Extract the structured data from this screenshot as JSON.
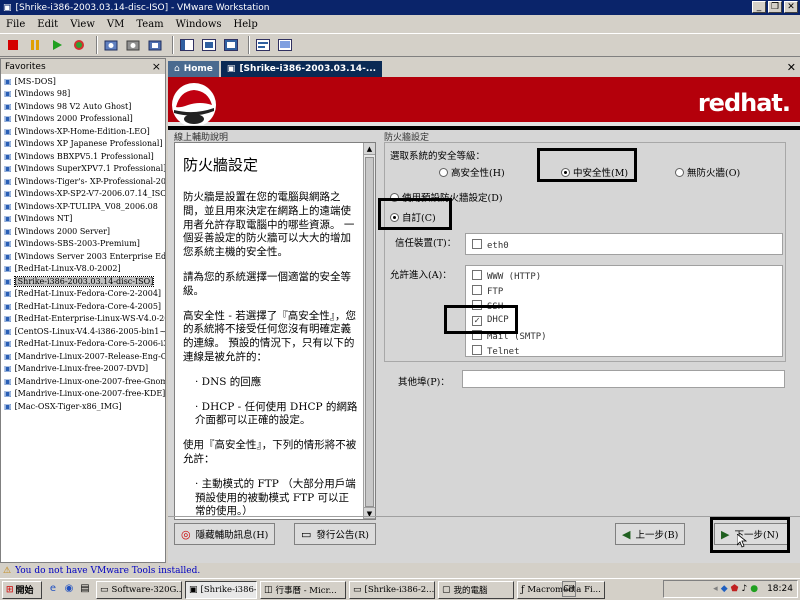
{
  "window": {
    "title": "[Shrike-i386-2003.03.14-disc-ISO] - VMware Workstation",
    "min": "_",
    "max": "❐",
    "close": "✕"
  },
  "menu": [
    "File",
    "Edit",
    "View",
    "VM",
    "Team",
    "Windows",
    "Help"
  ],
  "toolbar_icons": [
    "stop-icon",
    "pause-icon",
    "play-icon",
    "reset-icon",
    "snapshot-icon",
    "revert-icon",
    "manage-snapshots-icon",
    "sidebar-toggle-icon",
    "quick-switch-icon",
    "fullscreen-icon",
    "summary-icon",
    "console-icon"
  ],
  "sidebar": {
    "title": "Favorites",
    "close": "×",
    "items": [
      "[MS-DOS]",
      "[Windows 98]",
      "[Windows 98 V2 Auto Ghost]",
      "[Windows 2000 Professional]",
      "[Windows-XP-Home-Edition-LEO]",
      "[Windows XP Japanese Professional]",
      "[Windows BBXPV5.1 Professional]",
      "[Windows SuperXPV7.1 Professional]",
      "[Windows-Tiger's- XP-Professional-200",
      "[Windows-XP-SP2-V7-2006.07.14_ISO",
      "[Windows-XP-TULIPA_V08_2006.08",
      "[Windows NT]",
      "[Windows 2000 Server]",
      "[Windows-SBS-2003-Premium]",
      "[Windows Server 2003 Enterprise Editi",
      "[RedHat-Linux-V8.0-2002]",
      "[Shrike-i386-2003.03.14-disc-ISO]",
      "[RedHat-Linux-Fedora-Core-2-2004]",
      "[RedHat-Linux-Fedora-Core-4-2005]",
      "[RedHat-Enterprise-Linux-WS-V4.0-20",
      "[CentOS-Linux-V4.4-i386-2005-bin1~",
      "[RedHat-Linux-Fedora-Core-5-2006-i3",
      "[Mandrive-Linux-2007-Release-Eng-C",
      "[Mandrive-Linux-free-2007-DVD]",
      "[Mandrive-Linux-one-2007-free-Gnom",
      "[Mandrive-Linux-one-2007-free-KDE]",
      "[Mac-OSX-Tiger-x86_IMG]"
    ],
    "selected_index": 16
  },
  "tabs": [
    {
      "label": "Home",
      "icon": "home-icon"
    },
    {
      "label": "[Shrike-i386-2003.03.14-...",
      "icon": "vm-icon"
    }
  ],
  "tab_close": "✕",
  "guest": {
    "brand": "redhat.",
    "help_header": "線上輔助說明",
    "help_title": "防火牆設定",
    "help_paragraphs": [
      "防火牆是設置在您的電腦與網路之間，並且用來決定在網路上的遠端使用者允許存取電腦中的哪些資源。 一個妥善設定的防火牆可以大大的增加您系統主機的安全性。",
      "請為您的系統選擇一個適當的安全等級。",
      "高安全性 - 若選擇了『高安全性』，您的系統將不接受任何您沒有明確定義的連線。 預設的情況下，只有以下的連線是被允許的：",
      "· DNS 的回應",
      "· DHCP - 任何使用 DHCP 的網路介面都可以正確的設定。",
      "使用『高安全性』，下列的情形將不被允許：",
      "· 主動模式的 FTP （大部分用戶端預設使用的被動模式 FTP 可以正常的使用。）"
    ],
    "fw_header": "防火牆設定",
    "security_level_label": "選取系統的安全等級：",
    "levels": [
      {
        "label": "高安全性(H)",
        "checked": false
      },
      {
        "label": "中安全性(M)",
        "checked": true
      },
      {
        "label": "無防火牆(O)",
        "checked": false
      }
    ],
    "default_rules": {
      "label": "使用預設防火牆設定(D)",
      "checked": false
    },
    "custom": {
      "label": "自訂(C)",
      "checked": true
    },
    "trusted_label": "信任裝置(T)：",
    "trusted_devices": [
      {
        "label": "eth0",
        "checked": false
      }
    ],
    "allow_label": "允許進入(A)：",
    "services": [
      {
        "label": "WWW (HTTP)",
        "checked": false
      },
      {
        "label": "FTP",
        "checked": false
      },
      {
        "label": "SSH",
        "checked": false
      },
      {
        "label": "DHCP",
        "checked": true
      },
      {
        "label": "Mail (SMTP)",
        "checked": false
      },
      {
        "label": "Telnet",
        "checked": false
      }
    ],
    "other_ports_label": "其他埠(P)：",
    "other_ports_value": "",
    "btn_hide_help": "隱藏輔助訊息(H)",
    "btn_release_notes": "發行公告(R)",
    "btn_back": "上一步(B)",
    "btn_next": "下一步(N)"
  },
  "status": {
    "warning_icon": "warning-icon",
    "text": "You do not have VMware Tools installed."
  },
  "taskbar": {
    "start": "開始",
    "lang": "CH",
    "tasks": [
      {
        "label": "Software-320G...",
        "icon": "folder-icon",
        "active": false
      },
      {
        "label": "[Shrike-i386-2...",
        "icon": "vmware-icon",
        "active": true
      },
      {
        "label": "行事曆 - Micr...",
        "icon": "calendar-icon",
        "active": false
      },
      {
        "label": "[Shrike-i386-2...",
        "icon": "folder-icon",
        "active": false
      },
      {
        "label": "我的電腦",
        "icon": "computer-icon",
        "active": false
      },
      {
        "label": "Macromedia Fi...",
        "icon": "flash-icon",
        "active": false
      }
    ],
    "clock": "18:24"
  }
}
